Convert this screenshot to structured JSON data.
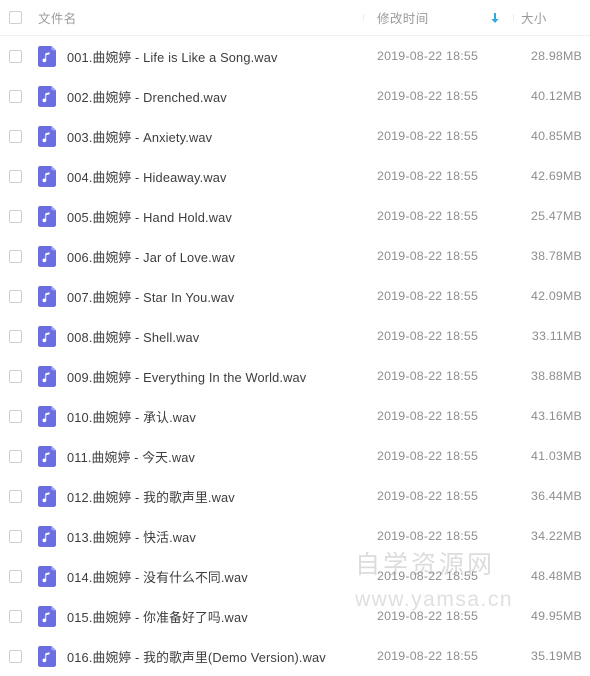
{
  "header": {
    "select_all_checkbox": "",
    "columns": [
      {
        "key": "name",
        "label": "文件名"
      },
      {
        "key": "time",
        "label": "修改时间"
      },
      {
        "key": "size",
        "label": "大小"
      }
    ],
    "name_label": "文件名",
    "time_label": "修改时间",
    "size_label": "大小",
    "sort_icon": "sort-descending-arrow-icon",
    "sort_column": "修改时间",
    "sort_direction": "descending",
    "sort_arrow_color": "#2eaadc"
  },
  "icons": {
    "file_icon_name": "music-file-icon",
    "file_icon_color": "#6b6ee0",
    "file_icon_fold_color": "#9a9cf0",
    "checkbox_icon_name": "checkbox-unchecked-icon"
  },
  "files": [
    {
      "name": "001.曲婉婷 - Life is Like a Song.wav",
      "time": "2019-08-22 18:55",
      "size": "28.98MB"
    },
    {
      "name": "002.曲婉婷 - Drenched.wav",
      "time": "2019-08-22 18:55",
      "size": "40.12MB"
    },
    {
      "name": "003.曲婉婷 - Anxiety.wav",
      "time": "2019-08-22 18:55",
      "size": "40.85MB"
    },
    {
      "name": "004.曲婉婷 - Hideaway.wav",
      "time": "2019-08-22 18:55",
      "size": "42.69MB"
    },
    {
      "name": "005.曲婉婷 - Hand Hold.wav",
      "time": "2019-08-22 18:55",
      "size": "25.47MB"
    },
    {
      "name": "006.曲婉婷 - Jar of Love.wav",
      "time": "2019-08-22 18:55",
      "size": "38.78MB"
    },
    {
      "name": "007.曲婉婷 - Star In You.wav",
      "time": "2019-08-22 18:55",
      "size": "42.09MB"
    },
    {
      "name": "008.曲婉婷 - Shell.wav",
      "time": "2019-08-22 18:55",
      "size": "33.11MB"
    },
    {
      "name": "009.曲婉婷 - Everything In the World.wav",
      "time": "2019-08-22 18:55",
      "size": "38.88MB"
    },
    {
      "name": "010.曲婉婷 - 承认.wav",
      "time": "2019-08-22 18:55",
      "size": "43.16MB"
    },
    {
      "name": "011.曲婉婷 - 今天.wav",
      "time": "2019-08-22 18:55",
      "size": "41.03MB"
    },
    {
      "name": "012.曲婉婷 - 我的歌声里.wav",
      "time": "2019-08-22 18:55",
      "size": "36.44MB"
    },
    {
      "name": "013.曲婉婷 - 快活.wav",
      "time": "2019-08-22 18:55",
      "size": "34.22MB"
    },
    {
      "name": "014.曲婉婷 - 没有什么不同.wav",
      "time": "2019-08-22 18:55",
      "size": "48.48MB"
    },
    {
      "name": "015.曲婉婷 - 你准备好了吗.wav",
      "time": "2019-08-22 18:55",
      "size": "49.95MB"
    },
    {
      "name": "016.曲婉婷 - 我的歌声里(Demo Version).wav",
      "time": "2019-08-22 18:55",
      "size": "35.19MB"
    }
  ],
  "watermark": {
    "line1": "自学资源网",
    "line2": "www.yamsa.cn"
  }
}
